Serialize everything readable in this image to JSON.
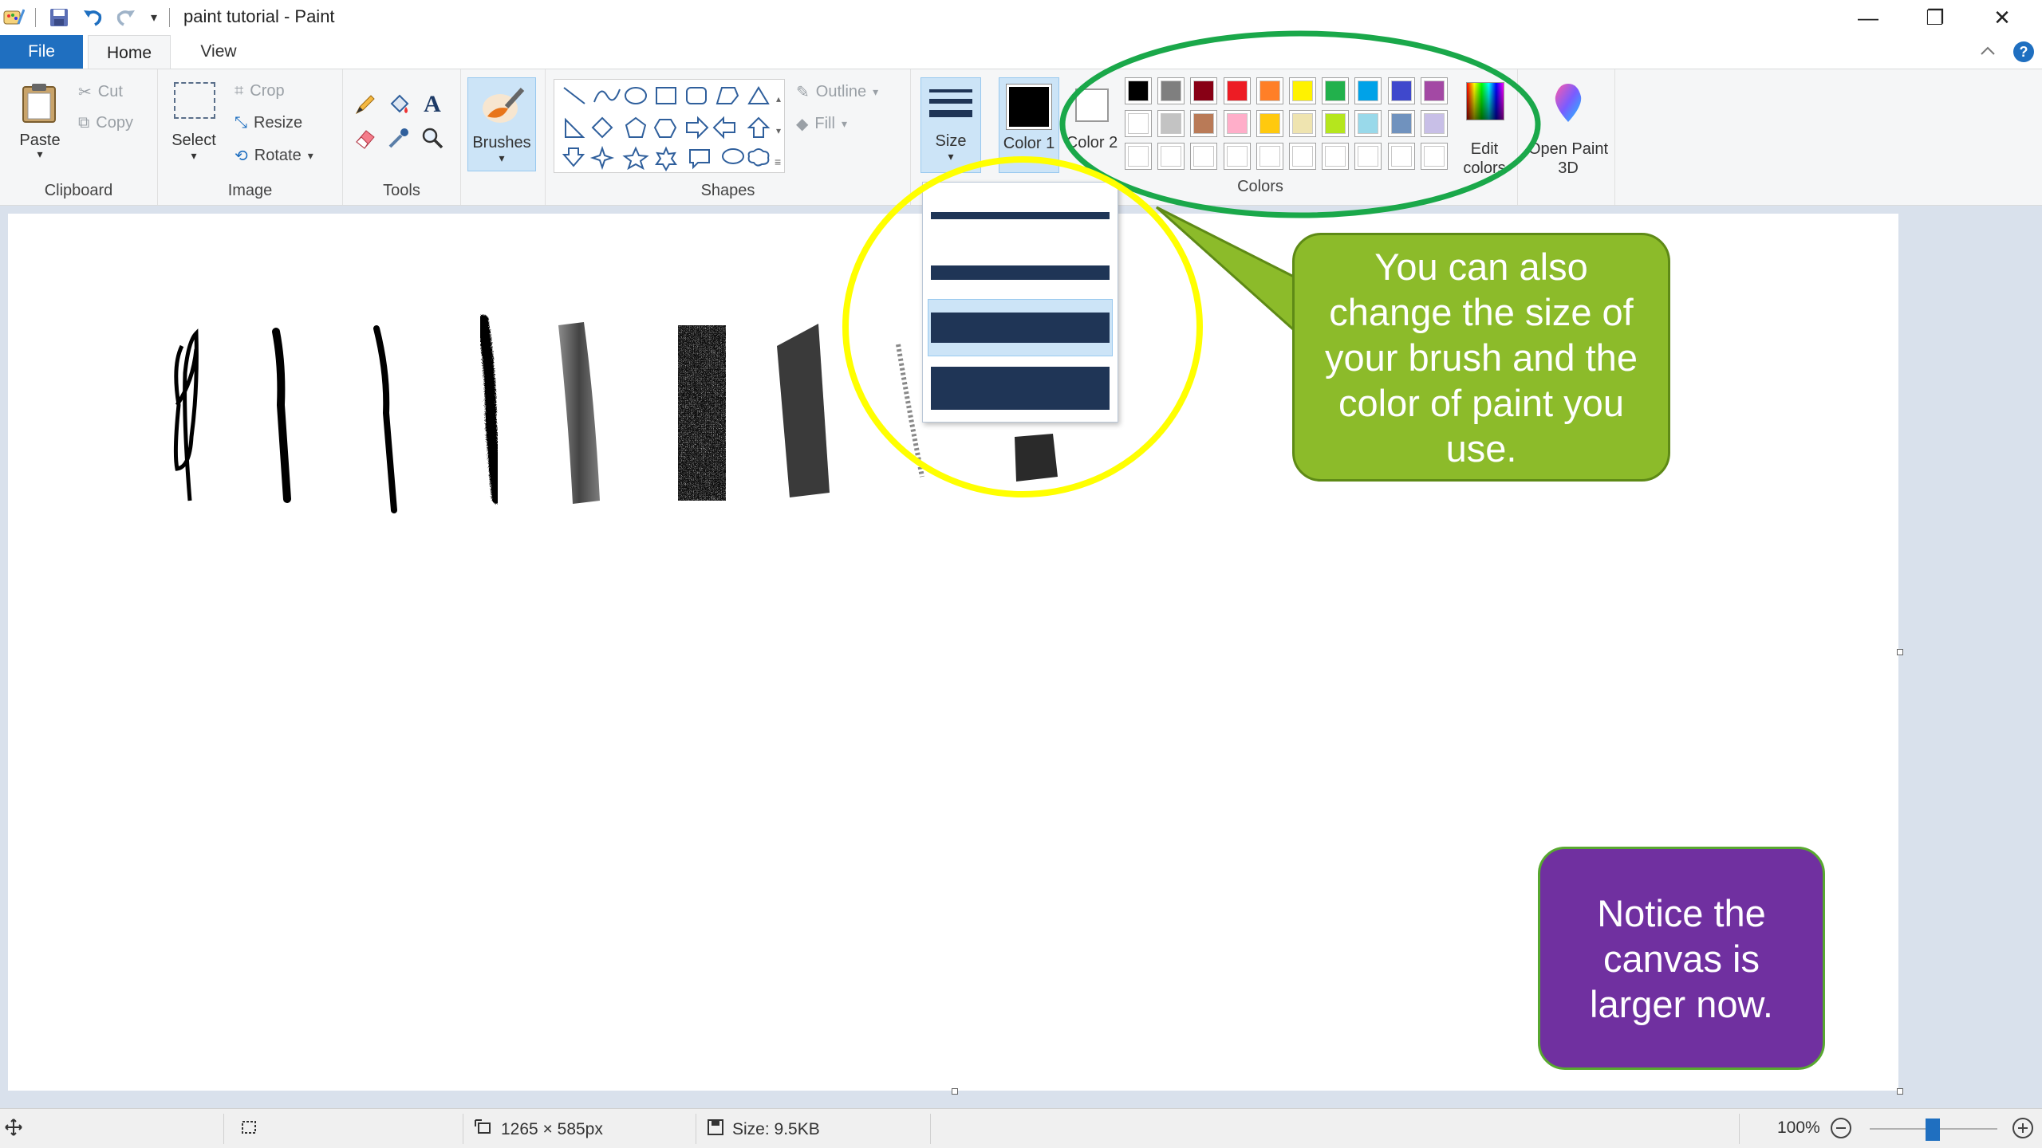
{
  "app": {
    "title": "paint tutorial - Paint"
  },
  "quick_access": {
    "save_icon": "save-icon",
    "undo_icon": "undo-icon",
    "redo_icon": "redo-icon",
    "customize_icon": "chevron-down-icon"
  },
  "window_controls": {
    "minimize": "—",
    "restore": "❐",
    "close": "✕"
  },
  "tabs": {
    "file": "File",
    "home": "Home",
    "view": "View",
    "collapse": "^",
    "help": "?"
  },
  "ribbon": {
    "clipboard": {
      "label": "Clipboard",
      "paste": "Paste",
      "cut": "Cut",
      "copy": "Copy"
    },
    "image": {
      "label": "Image",
      "select": "Select",
      "crop": "Crop",
      "resize": "Resize",
      "rotate": "Rotate"
    },
    "tools": {
      "label": "Tools"
    },
    "brushes": {
      "label": "Brushes"
    },
    "shapes": {
      "label": "Shapes",
      "outline": "Outline",
      "fill": "Fill"
    },
    "size": {
      "label": "Size"
    },
    "colors": {
      "label": "Colors",
      "color1": "Color 1",
      "color2": "Color 2",
      "edit_colors": "Edit colors",
      "palette_row1": [
        "#000000",
        "#7f7f7f",
        "#880015",
        "#ed1c24",
        "#ff7f27",
        "#fff200",
        "#22b14c",
        "#00a2e8",
        "#3f48cc",
        "#a349a4"
      ],
      "palette_row2": [
        "#ffffff",
        "#c3c3c3",
        "#b97a57",
        "#ffaec9",
        "#ffc90e",
        "#efe4b0",
        "#b5e61d",
        "#99d9ea",
        "#7092be",
        "#c8bfe7"
      ],
      "primary": "#000000",
      "secondary": "#ffffff"
    },
    "paint3d": {
      "label": "Open Paint 3D"
    }
  },
  "size_dropdown": {
    "options": [
      1,
      3,
      5,
      8
    ],
    "selected_index": 2
  },
  "callouts": {
    "size_color": "You can also change the size of your brush and the color of paint you use.",
    "canvas": "Notice the canvas is larger now."
  },
  "status": {
    "canvas_size": "1265 × 585px",
    "file_size": "Size: 9.5KB",
    "zoom": "100%",
    "zoom_level": 1.0
  },
  "colors": {
    "accent": "#1f6fc0",
    "highlight_yellow": "#ffff00",
    "highlight_green": "#1aa84a",
    "callout_green": "#8cbb2a",
    "callout_purple": "#7030a0",
    "brush_blue": "#1f3556"
  }
}
